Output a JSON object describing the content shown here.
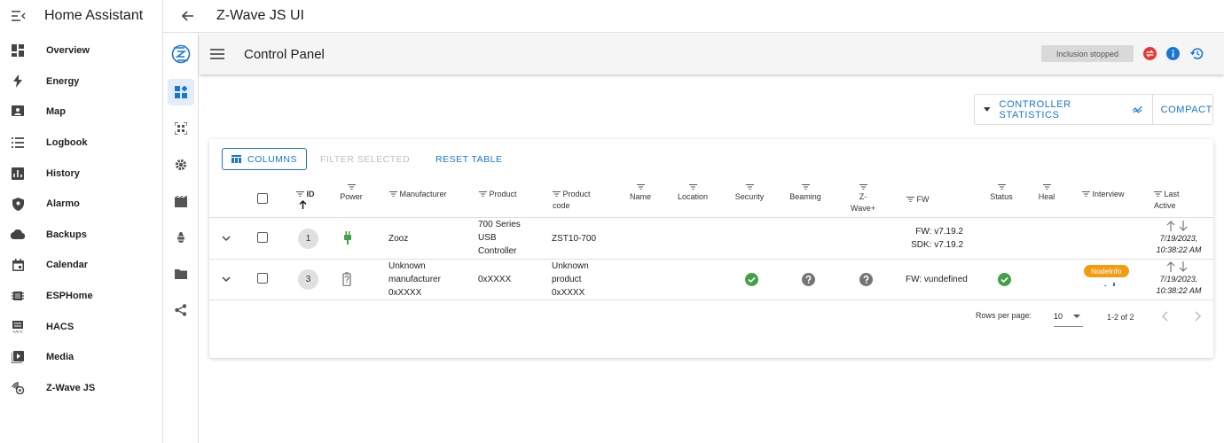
{
  "ha": {
    "title": "Home Assistant",
    "items": [
      {
        "label": "Overview",
        "icon": "dashboard-icon"
      },
      {
        "label": "Energy",
        "icon": "bolt-icon"
      },
      {
        "label": "Map",
        "icon": "map-icon"
      },
      {
        "label": "Logbook",
        "icon": "list-icon"
      },
      {
        "label": "History",
        "icon": "chart-icon"
      },
      {
        "label": "Alarmo",
        "icon": "shield-icon"
      },
      {
        "label": "Backups",
        "icon": "cloud-icon"
      },
      {
        "label": "Calendar",
        "icon": "calendar-icon"
      },
      {
        "label": "ESPHome",
        "icon": "chip-icon"
      },
      {
        "label": "HACS",
        "icon": "hacs-icon"
      },
      {
        "label": "Media",
        "icon": "media-icon"
      },
      {
        "label": "Z-Wave JS",
        "icon": "zwave-icon"
      }
    ]
  },
  "topbar": {
    "title": "Z-Wave JS UI"
  },
  "appbar": {
    "title": "Control Panel",
    "inclusion": "Inclusion stopped"
  },
  "stats": {
    "controller": "CONTROLLER STATISTICS",
    "compact": "COMPACT"
  },
  "toolbar": {
    "columns": "COLUMNS",
    "filter": "FILTER SELECTED",
    "reset": "RESET TABLE"
  },
  "table": {
    "headers": {
      "id": "ID",
      "power": "Power",
      "manufacturer": "Manufacturer",
      "product": "Product",
      "product_code_1": "Product",
      "product_code_2": "code",
      "name": "Name",
      "location": "Location",
      "security": "Security",
      "beaming": "Beaming",
      "zwaveplus": "Z-Wave+",
      "fw": "FW",
      "status": "Status",
      "heal": "Heal",
      "interview": "Interview",
      "last_active_1": "Last",
      "last_active_2": "Active"
    },
    "rows": [
      {
        "id": "1",
        "manufacturer": [
          "Zooz"
        ],
        "product": [
          "700 Series",
          "USB",
          "Controller"
        ],
        "product_code": [
          "ZST10-700"
        ],
        "fw": [
          "FW: v7.19.2",
          "SDK: v7.19.2"
        ],
        "date": [
          "7/19/2023,",
          "10:38:22 AM"
        ]
      },
      {
        "id": "3",
        "manufacturer": [
          "Unknown",
          "manufacturer",
          "0xXXXX"
        ],
        "product": [
          "0xXXXX"
        ],
        "product_code": [
          "Unknown",
          "product",
          "0xXXXX"
        ],
        "fw": [
          "FW: vundefined"
        ],
        "interview": "NodeInfo",
        "date": [
          "7/19/2023,",
          "10:38:22 AM"
        ]
      }
    ]
  },
  "pagination": {
    "rows_label": "Rows per page:",
    "rows_value": "10",
    "range": "1-2 of 2"
  },
  "colors": {
    "primary": "#1976d2",
    "success": "#43a047",
    "warning": "#f39c12",
    "danger": "#e53935"
  }
}
